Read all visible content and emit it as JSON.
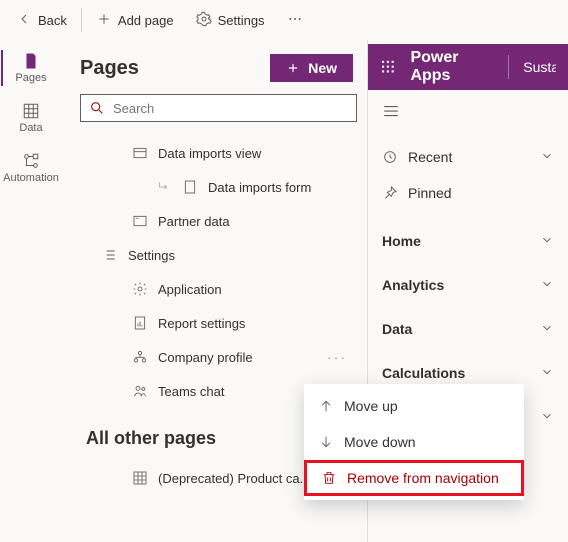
{
  "topbar": {
    "back": "Back",
    "add_page": "Add page",
    "settings": "Settings"
  },
  "leftnav": {
    "pages": "Pages",
    "data": "Data",
    "automation": "Automation"
  },
  "center": {
    "title": "Pages",
    "new_label": "New",
    "search_placeholder": "Search",
    "nodes": {
      "data_imports_view": "Data imports view",
      "data_imports_form": "Data imports form",
      "partner_data": "Partner data",
      "settings": "Settings",
      "application": "Application",
      "report_settings": "Report settings",
      "company_profile": "Company profile",
      "teams_chat": "Teams chat"
    },
    "all_other": "All other pages",
    "deprecated_product": "(Deprecated) Product ca..."
  },
  "rightpanel": {
    "brand": "Power Apps",
    "subbrand": "Susta",
    "recent": "Recent",
    "pinned": "Pinned",
    "sections": {
      "home": "Home",
      "analytics": "Analytics",
      "data": "Data",
      "calculations": "Calculations"
    }
  },
  "context_menu": {
    "move_up": "Move up",
    "move_down": "Move down",
    "remove": "Remove from navigation"
  }
}
